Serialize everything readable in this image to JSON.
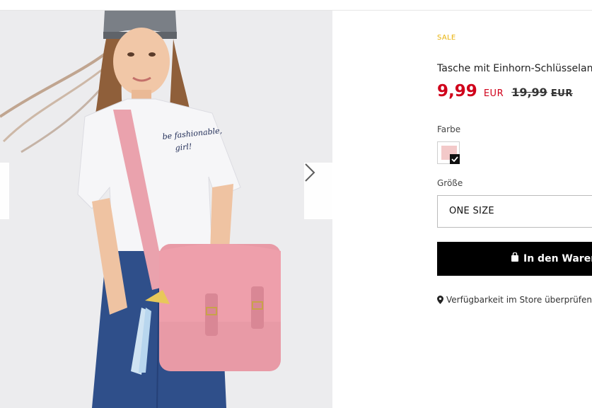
{
  "product": {
    "badge": "SALE",
    "title": "Tasche mit Einhorn-Schlüsselan",
    "price_current": "9,99",
    "currency_current": "EUR",
    "price_old": "19,99",
    "currency_old": "EUR",
    "color_label": "Farbe",
    "selected_color": "#f3c9c9",
    "size_label": "Größe",
    "size_value": "ONE SIZE",
    "cart_button_label": "In den Waren",
    "store_link": "Verfügbarkeit im Store überprüfen"
  },
  "gallery": {
    "shirt_print": [
      "be fashionable,",
      "girl!"
    ],
    "next_icon": "chevron-right-icon",
    "prev_icon": "chevron-left-icon"
  },
  "colors": {
    "sale_badge": "#e8b20a",
    "price": "#d0021b",
    "button_bg": "#000000",
    "bag_pink": "#e79aa6"
  }
}
